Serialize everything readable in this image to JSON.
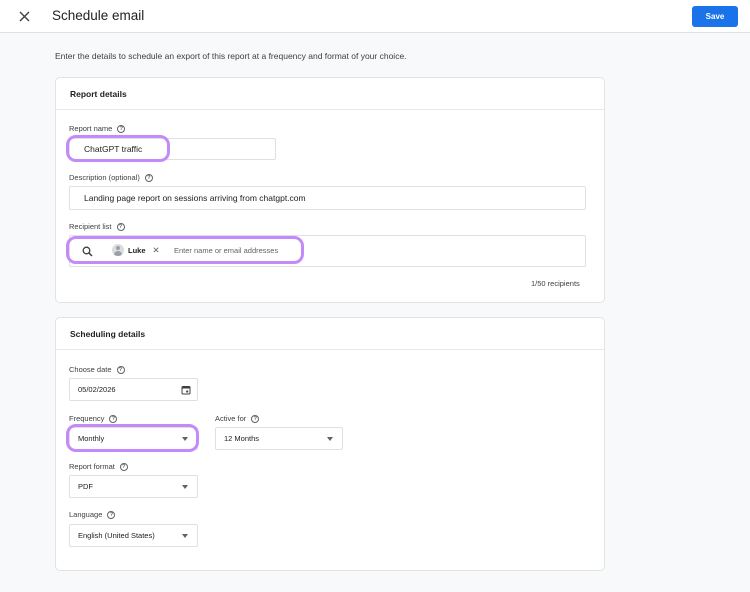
{
  "header": {
    "title": "Schedule email",
    "save_label": "Save"
  },
  "intro": "Enter the details to schedule an export of this report at a frequency and format of your choice.",
  "report_details": {
    "title": "Report details",
    "report_name": {
      "label": "Report name",
      "value": "ChatGPT traffic"
    },
    "description": {
      "label": "Description (optional)",
      "value": "Landing page report on sessions arriving from chatgpt.com"
    },
    "recipients": {
      "label": "Recipient list",
      "chip": "Luke",
      "placeholder": "Enter name or email addresses",
      "count": "1/50 recipients"
    }
  },
  "scheduling": {
    "title": "Scheduling details",
    "date": {
      "label": "Choose date",
      "value": "05/02/2026"
    },
    "frequency": {
      "label": "Frequency",
      "value": "Monthly"
    },
    "active_for": {
      "label": "Active for",
      "value": "12 Months"
    },
    "format": {
      "label": "Report format",
      "value": "PDF"
    },
    "language": {
      "label": "Language",
      "value": "English (United States)"
    }
  },
  "colors": {
    "accent": "#1a73e8",
    "highlight": "#c58af9"
  },
  "icons": [
    "close-icon",
    "help-icon",
    "search-icon",
    "calendar-icon",
    "dropdown-caret-icon",
    "avatar-icon"
  ]
}
